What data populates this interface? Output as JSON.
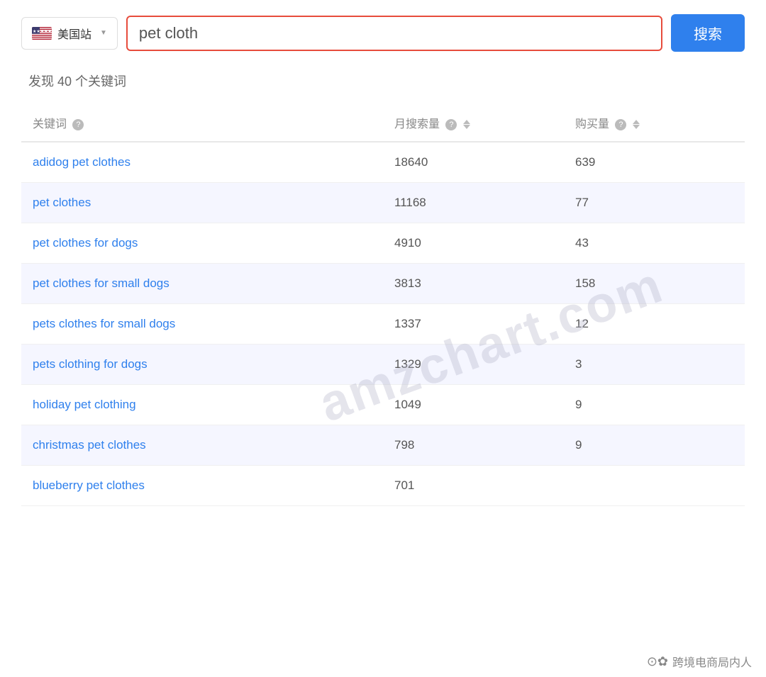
{
  "site_selector": {
    "label": "美国站",
    "chevron": "▼"
  },
  "search": {
    "value": "pet cloth",
    "placeholder": "pet cloth",
    "button_label": "搜索"
  },
  "result_summary": {
    "text": "发现 40 个关键词"
  },
  "table": {
    "headers": {
      "keyword": "关键词",
      "monthly_search": "月搜索量",
      "purchase": "购买量"
    },
    "rows": [
      {
        "keyword": "adidog pet clothes",
        "monthly_search": "18640",
        "purchase": "639"
      },
      {
        "keyword": "pet clothes",
        "monthly_search": "11168",
        "purchase": "77"
      },
      {
        "keyword": "pet clothes for dogs",
        "monthly_search": "4910",
        "purchase": "43"
      },
      {
        "keyword": "pet clothes for small dogs",
        "monthly_search": "3813",
        "purchase": "158"
      },
      {
        "keyword": "pets clothes for small dogs",
        "monthly_search": "1337",
        "purchase": "12"
      },
      {
        "keyword": "pets clothing for dogs",
        "monthly_search": "1329",
        "purchase": "3"
      },
      {
        "keyword": "holiday pet clothing",
        "monthly_search": "1049",
        "purchase": "9"
      },
      {
        "keyword": "christmas pet clothes",
        "monthly_search": "798",
        "purchase": "9"
      },
      {
        "keyword": "blueberry pet clothes",
        "monthly_search": "701",
        "purchase": ""
      }
    ]
  },
  "watermark": {
    "text": "amzchart.com"
  },
  "bottom_bar": {
    "icon": "✿",
    "text": "跨境电商局内人"
  }
}
